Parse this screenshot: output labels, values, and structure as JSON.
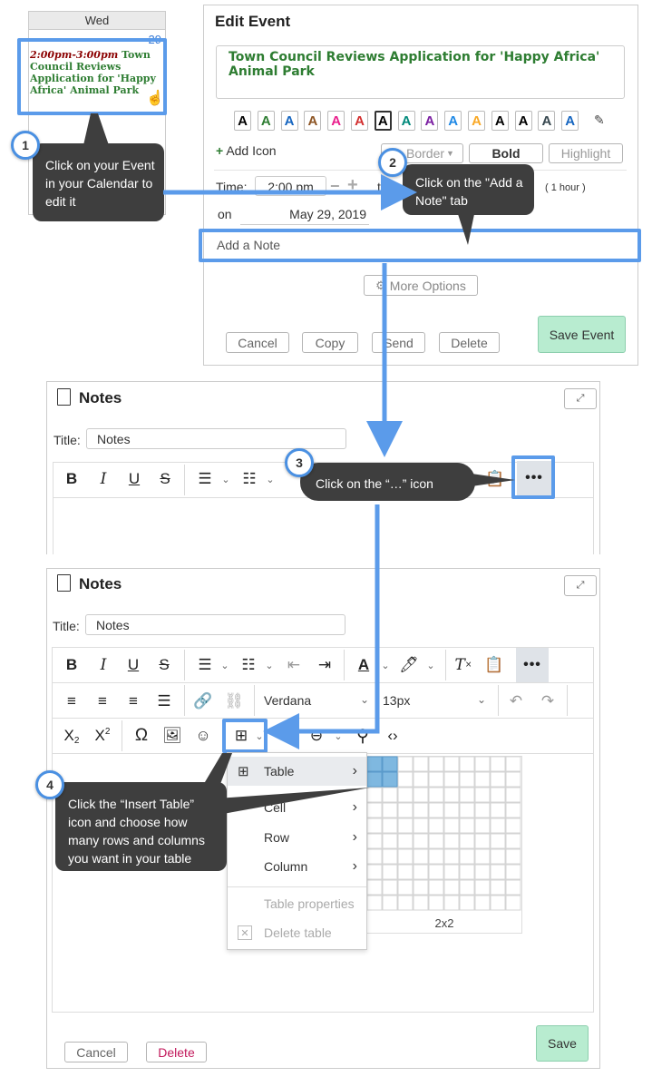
{
  "calendar": {
    "day": "Wed",
    "date": "29",
    "event_time": "2:00pm-3:00pm",
    "event_title": "Town Council Reviews Application for 'Happy Africa' Animal Park"
  },
  "edit_event": {
    "heading": "Edit Event",
    "title_value": "Town Council Reviews Application for 'Happy Africa' Animal Park",
    "swatch_letter": "A",
    "swatch_colors": [
      "#000000",
      "#2e7d32",
      "#1565c0",
      "#8d5524",
      "#e91e8c",
      "#d32f2f",
      "#000000",
      "#00897b",
      "#7b1fa2",
      "#1e88e5",
      "#f9a825",
      "#000000",
      "#000000",
      "#37474f",
      "#1565c0"
    ],
    "add_icon": "Add Icon",
    "border_label": "Border",
    "bold_label": "Bold",
    "highlight_label": "Highlight",
    "time_label": "Time:",
    "time_value": "2:00 pm",
    "to_label": "to",
    "duration": "( 1 hour )",
    "on_label": "on",
    "date_value": "May 29, 2019",
    "add_note": "Add a Note",
    "more_options": "More Options",
    "cancel": "Cancel",
    "copy": "Copy",
    "send": "Send",
    "delete": "Delete",
    "save_event": "Save Event"
  },
  "callouts": {
    "c1_number": "1",
    "c1_text": "Click on your Event in your Calendar to edit it",
    "c2_number": "2",
    "c2_text": "Click on the \"Add a Note\" tab",
    "c3_number": "3",
    "c3_text": "Click on the “…” icon",
    "c4_number": "4",
    "c4_text": "Click the “Insert Table” icon and choose how many rows and columns you want in your table"
  },
  "notes_top": {
    "heading": "Notes",
    "title_label": "Title:",
    "title_value": "Notes"
  },
  "notes_bottom": {
    "heading": "Notes",
    "title_label": "Title:",
    "title_value": "Notes",
    "font_family": "Verdana",
    "font_size": "13px",
    "table_menu": {
      "table": "Table",
      "cell": "Cell",
      "row": "Row",
      "column": "Column",
      "table_properties": "Table properties",
      "delete_table": "Delete table"
    },
    "grid_label": "2x2",
    "cancel": "Cancel",
    "delete": "Delete",
    "save": "Save"
  },
  "colors": {
    "accent_blue": "#5b9bea",
    "save_green": "#b8ecd0",
    "event_time_red": "#8b0000",
    "event_title_green": "#2e7d32",
    "callout_dark": "#3e3e3e"
  }
}
